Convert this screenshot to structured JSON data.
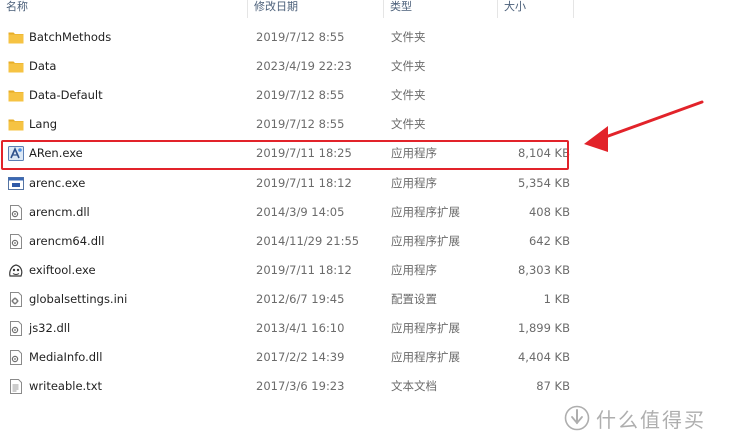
{
  "columns": {
    "name": "名称",
    "date": "修改日期",
    "type": "类型",
    "size": "大小"
  },
  "files": [
    {
      "name": "BatchMethods",
      "date": "2019/7/12 8:55",
      "type": "文件夹",
      "size": "",
      "icon": "folder-icon"
    },
    {
      "name": "Data",
      "date": "2023/4/19 22:23",
      "type": "文件夹",
      "size": "",
      "icon": "folder-icon"
    },
    {
      "name": "Data-Default",
      "date": "2019/7/12 8:55",
      "type": "文件夹",
      "size": "",
      "icon": "folder-icon"
    },
    {
      "name": "Lang",
      "date": "2019/7/12 8:55",
      "type": "文件夹",
      "size": "",
      "icon": "folder-icon"
    },
    {
      "name": "ARen.exe",
      "date": "2019/7/11 18:25",
      "type": "应用程序",
      "size": "8,104 KB",
      "icon": "aren-app-icon"
    },
    {
      "name": "arenc.exe",
      "date": "2019/7/11 18:12",
      "type": "应用程序",
      "size": "5,354 KB",
      "icon": "console-app-icon"
    },
    {
      "name": "arencm.dll",
      "date": "2014/3/9 14:05",
      "type": "应用程序扩展",
      "size": "408 KB",
      "icon": "dll-file-icon"
    },
    {
      "name": "arencm64.dll",
      "date": "2014/11/29 21:55",
      "type": "应用程序扩展",
      "size": "642 KB",
      "icon": "dll-file-icon"
    },
    {
      "name": "exiftool.exe",
      "date": "2019/7/11 18:12",
      "type": "应用程序",
      "size": "8,303 KB",
      "icon": "exiftool-app-icon"
    },
    {
      "name": "globalsettings.ini",
      "date": "2012/6/7 19:45",
      "type": "配置设置",
      "size": "1 KB",
      "icon": "settings-file-icon"
    },
    {
      "name": "js32.dll",
      "date": "2013/4/1 16:10",
      "type": "应用程序扩展",
      "size": "1,899 KB",
      "icon": "dll-file-icon"
    },
    {
      "name": "MediaInfo.dll",
      "date": "2017/2/2 14:39",
      "type": "应用程序扩展",
      "size": "4,404 KB",
      "icon": "dll-file-icon"
    },
    {
      "name": "writeable.txt",
      "date": "2017/3/6 19:23",
      "type": "文本文档",
      "size": "87 KB",
      "icon": "text-file-icon"
    }
  ],
  "highlighted_file": "ARen.exe",
  "colors": {
    "highlight": "#e2232a",
    "folder": "#f6c343",
    "header_text": "#4c607a"
  },
  "watermark": {
    "text": "什么值得买"
  }
}
